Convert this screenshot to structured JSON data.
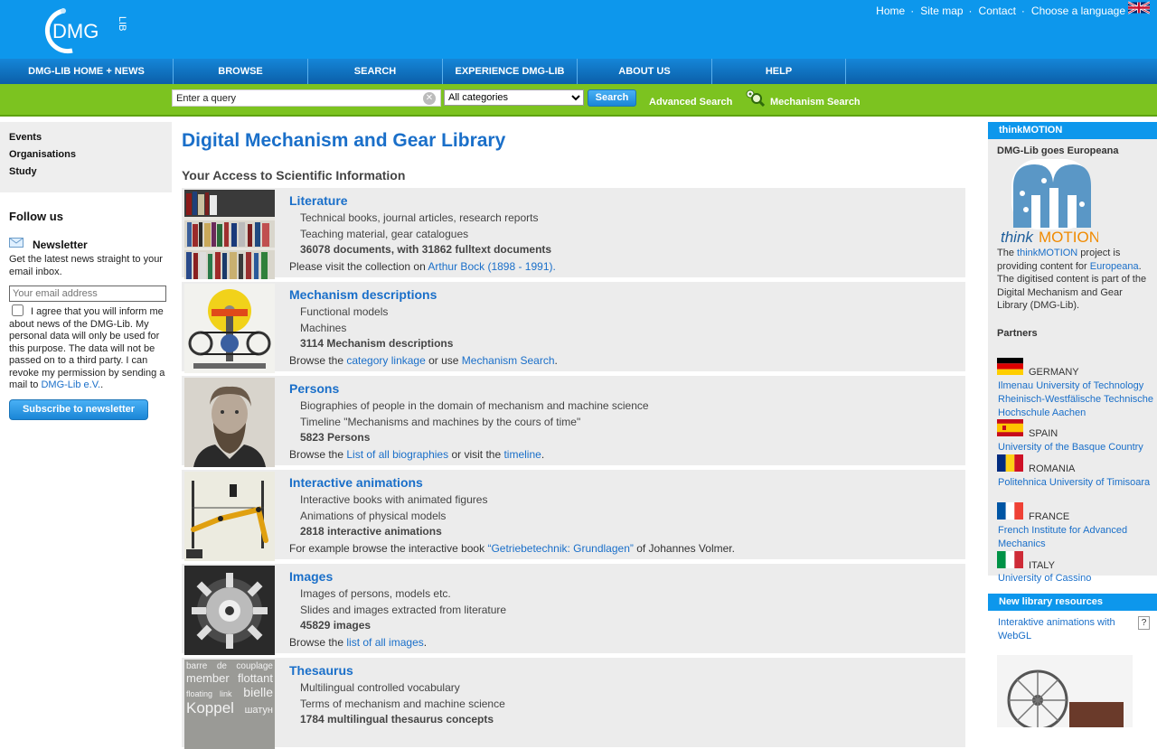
{
  "header": {
    "logo_text": "DMG",
    "logo_sub": "LIB",
    "links": [
      "Home",
      "Site map",
      "Contact",
      "Choose a language"
    ]
  },
  "nav": {
    "items": [
      "DMG-LIB HOME + NEWS",
      "BROWSE",
      "SEARCH",
      "EXPERIENCE DMG-LIB",
      "ABOUT US",
      "HELP"
    ]
  },
  "search": {
    "query_value": "Enter a query",
    "category_selected": "All categories",
    "button_label": "Search",
    "advanced_label": "Advanced Search",
    "mechanism_label": "Mechanism Search"
  },
  "left": {
    "nav_items": [
      "Events",
      "Organisations",
      "Study"
    ],
    "follow_title": "Follow us",
    "newsletter_title": "Newsletter",
    "newsletter_text": "Get the latest news straight to your email inbox.",
    "email_placeholder": "Your email address",
    "agree_text": "I agree that you will inform me about news of the DMG-Lib. My personal data will only be used for this purpose. The data will not be passed on to a third party. I can revoke my permission by sending a mail to",
    "agree_link": "DMG-Lib e.V.",
    "agree_end": ".",
    "subscribe_label": "Subscribe to newsletter"
  },
  "main": {
    "title": "Digital Mechanism and Gear Library",
    "subtitle": "Your Access to Scientific Information",
    "entries": [
      {
        "title": "Literature",
        "lines": [
          "Technical books, journal articles, research reports",
          "Teaching material, gear catalogues"
        ],
        "count": "36078 documents, with 31862 fulltext documents",
        "foot_pre": "Please visit the collection on ",
        "foot_link1": "Arthur Bock (1898 - 1991).",
        "foot_mid": "",
        "foot_link2": "",
        "foot_end": ""
      },
      {
        "title": "Mechanism descriptions",
        "lines": [
          "Functional models",
          "Machines"
        ],
        "count": "3114 Mechanism descriptions",
        "foot_pre": "Browse the ",
        "foot_link1": "category linkage",
        "foot_mid": " or use ",
        "foot_link2": "Mechanism Search",
        "foot_end": "."
      },
      {
        "title": "Persons",
        "lines": [
          "Biographies of people in the domain of mechanism and machine science",
          "Timeline \"Mechanisms and machines by the cours of time\""
        ],
        "count": "5823 Persons",
        "foot_pre": "Browse the ",
        "foot_link1": "List of all biographies",
        "foot_mid": " or visit the ",
        "foot_link2": "timeline",
        "foot_end": "."
      },
      {
        "title": "Interactive animations",
        "lines": [
          "Interactive books with animated figures",
          "Animations of physical models"
        ],
        "count": "2818 interactive animations",
        "foot_pre": "For example browse the interactive book ",
        "foot_link1": "“Getriebetechnik: Grundlagen”",
        "foot_mid": " of Johannes Volmer.",
        "foot_link2": "",
        "foot_end": ""
      },
      {
        "title": "Images",
        "lines": [
          "Images of persons, models etc.",
          "Slides and images extracted from literature"
        ],
        "count": "45829 images",
        "foot_pre": "Browse the ",
        "foot_link1": "list of all images",
        "foot_mid": ".",
        "foot_link2": "",
        "foot_end": ""
      },
      {
        "title": "Thesaurus",
        "lines": [
          "Multilingual controlled vocabulary",
          "Terms of mechanism and machine science"
        ],
        "count": "1784 multilingual thesaurus concepts",
        "foot_pre": "",
        "foot_link1": "",
        "foot_mid": "",
        "foot_link2": "",
        "foot_end": ""
      }
    ],
    "thesaurus_words": [
      "barre",
      "de",
      "couplage",
      "member",
      "flottant",
      "floating",
      "link",
      "bielle",
      "Koppel",
      "шатун"
    ]
  },
  "right": {
    "tm_header": "thinkMOTION",
    "tm_subhead": "DMG-Lib goes Europeana",
    "tm_logo_think": "think",
    "tm_logo_motion": "MOTION",
    "tm_text_1": "The ",
    "tm_link_1": "thinkMOTION",
    "tm_text_2": " project is providing content for ",
    "tm_link_2": "Europeana",
    "tm_text_3": ". The digitised content is part of the Digital Mechanism and Gear Library (DMG-Lib).",
    "partners_title": "Partners",
    "partners": [
      {
        "country": "GERMANY",
        "links": [
          "Ilmenau University of Technology",
          "Rheinisch-Westfälische Technische Hochschule Aachen"
        ]
      },
      {
        "country": "SPAIN",
        "links": [
          "University of the Basque Country"
        ]
      },
      {
        "country": "ROMANIA",
        "links": [
          "Politehnica University of Timisoara"
        ]
      },
      {
        "country": "FRANCE",
        "links": [
          "French Institute for Advanced Mechanics"
        ]
      },
      {
        "country": "ITALY",
        "links": [
          "University of Cassino"
        ]
      }
    ],
    "new_resources_header": "New library resources",
    "new_resources_link": "Interaktive animations with WebGL",
    "help_mark": "?"
  },
  "colors": {
    "header_blue": "#0d97ec",
    "nav_blue": "#0b5fa8",
    "search_green": "#7cc320",
    "link_blue": "#1a6fc9"
  }
}
